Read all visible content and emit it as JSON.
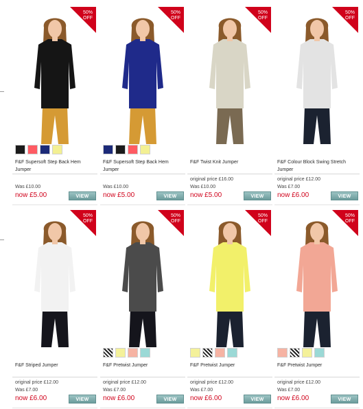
{
  "products": [
    {
      "name": "F&F Supersoft Step Back Hem Jumper",
      "original": "",
      "was": "Was £10.00",
      "now": "now £5.00",
      "view": "VIEW",
      "badge": [
        "50%",
        "OFF"
      ],
      "top_color": "#151515",
      "pants_color": "#d59a34",
      "swatches": [
        "#1b1b1b",
        "#ff5b63",
        "#1c2a78",
        "#f3f093"
      ]
    },
    {
      "name": "F&F Supersoft Step Back Hem Jumper",
      "original": "",
      "was": "Was £10.00",
      "now": "now £5.00",
      "view": "VIEW",
      "badge": [
        "50%",
        "OFF"
      ],
      "top_color": "#1f2a8a",
      "pants_color": "#d59a34",
      "swatches": [
        "#1c2a78",
        "#1b1b1b",
        "#ff5b63",
        "#f3f093"
      ]
    },
    {
      "name": "F&F Twist Knit Jumper",
      "original": "original price £16.00",
      "was": "Was £10.00",
      "now": "now £5.00",
      "view": "VIEW",
      "badge": [
        "50%",
        "OFF"
      ],
      "top_color": "#d9d6c6",
      "pants_color": "#7a6a52",
      "swatches": []
    },
    {
      "name": "F&F Colour Block Swing Stretch Jumper",
      "original": "original price £12.00",
      "was": "Was £7.00",
      "now": "now £6.00",
      "view": "VIEW",
      "badge": [
        "50%",
        "OFF"
      ],
      "top_color": "#e3e3e3",
      "pants_color": "#1b2230",
      "swatches": []
    },
    {
      "name": "F&F Striped Jumper",
      "original": "original price £12.00",
      "was": "Was £7.00",
      "now": "now £6.00",
      "view": "VIEW",
      "badge": [
        "50%",
        "OFF"
      ],
      "top_color": "#f2f2f2",
      "pants_color": "#15151c",
      "swatches": []
    },
    {
      "name": "F&F Pretwist Jumper",
      "original": "original price £12.00",
      "was": "Was £7.00",
      "now": "now £6.00",
      "view": "VIEW",
      "badge": [
        "50%",
        "OFF"
      ],
      "top_color": "#4b4b4b",
      "pants_color": "#15151c",
      "swatches": [
        "pattern",
        "#f4f19a",
        "#f6b3a3",
        "#9bd9d6"
      ]
    },
    {
      "name": "F&F Pretwist Jumper",
      "original": "original price £12.00",
      "was": "Was £7.00",
      "now": "now £6.00",
      "view": "VIEW",
      "badge": [
        "50%",
        "OFF"
      ],
      "top_color": "#f2f06a",
      "pants_color": "#1b2230",
      "swatches": [
        "#f4f19a",
        "pattern",
        "#f6b3a3",
        "#9bd9d6"
      ]
    },
    {
      "name": "F&F Pretwist Jumper",
      "original": "original price £12.00",
      "was": "Was £7.00",
      "now": "now £6.00",
      "view": "VIEW",
      "badge": [
        "50%",
        "OFF"
      ],
      "top_color": "#f2a795",
      "pants_color": "#1b2230",
      "swatches": [
        "#f6b3a3",
        "pattern",
        "#f4f19a",
        "#9bd9d6"
      ]
    }
  ],
  "theme": {
    "badge_red": "#d0021b",
    "price_red": "#d0021b",
    "view_button": "#7fa9a9"
  }
}
